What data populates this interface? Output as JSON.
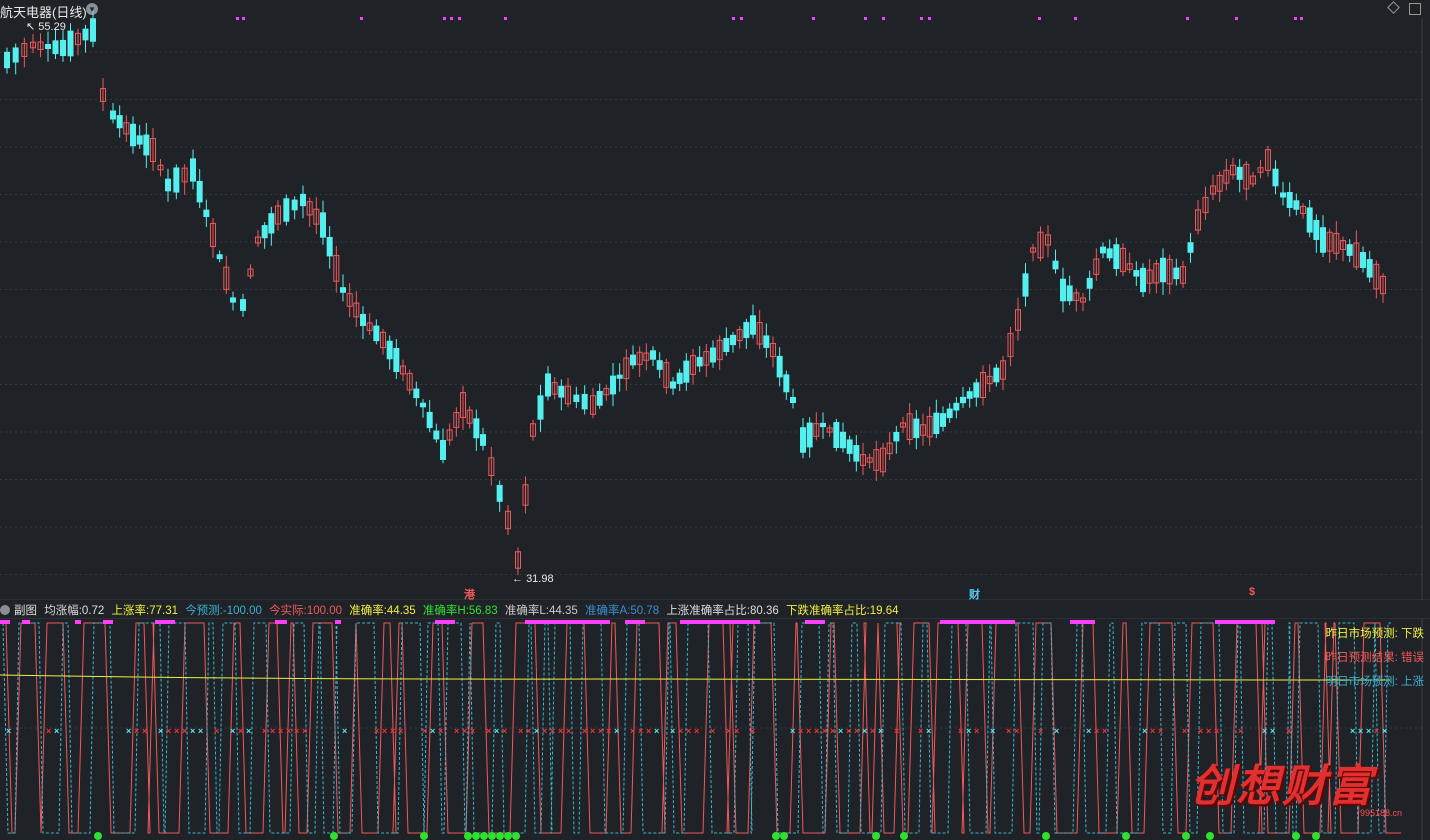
{
  "header": {
    "title": "航天电器(日线)",
    "high_label": "55.29",
    "low_label": "31.98"
  },
  "markers": {
    "gang": "港",
    "cai": "财",
    "dollar": "$"
  },
  "sub_header": {
    "section": "副图",
    "avg_label": "均涨幅:",
    "avg_value": "0.72",
    "up_rate_label": "上涨率:",
    "up_rate_value": "77.31",
    "today_pred_label": "今预测:",
    "today_pred_value": "-100.00",
    "today_actual_label": "今实际:",
    "today_actual_value": "100.00",
    "acc_label": "准确率:",
    "acc_value": "44.35",
    "acc_h_label": "准确率H:",
    "acc_h_value": "56.83",
    "acc_l_label": "准确率L:",
    "acc_l_value": "44.35",
    "acc_a_label": "准确率A:",
    "acc_a_value": "50.78",
    "up_share_label": "上涨准确率占比:",
    "up_share_value": "80.36",
    "down_share_label": "下跌准确率占比:",
    "down_share_value": "19.64"
  },
  "legend": {
    "yesterday_pred": "昨日市场预测: 下跌",
    "yesterday_result": "昨日预测结果: 错误",
    "tomorrow_pred": "明日市场预测: 上涨"
  },
  "watermark": {
    "text": "创想财富",
    "url": "995188.cn"
  },
  "colors": {
    "bg": "#1f2227",
    "up": "#f05a5a",
    "down": "#54f0f0",
    "magenta": "#ff40ff",
    "yellow": "#f0f040",
    "green": "#30e030"
  }
}
